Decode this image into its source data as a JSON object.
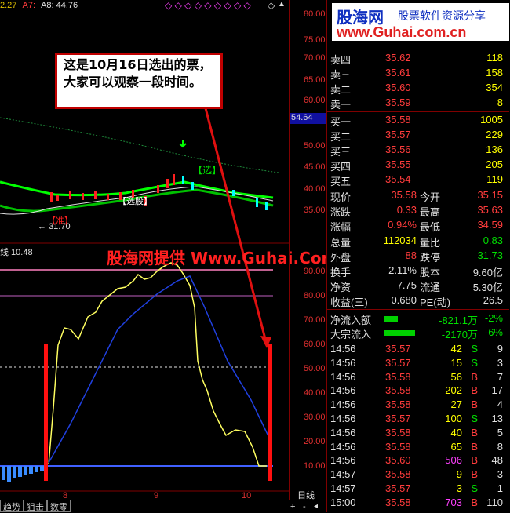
{
  "header": {
    "ma_a": "A7:",
    "ma_b": "A8: 44.76",
    "ma_left": "2.27",
    "prev_val": "54.64"
  },
  "watermark": {
    "logo": "股海网",
    "tagline": "股票软件资源分享",
    "url": "www.Guhai.com.cn",
    "overlay": "股海网提供 Www.Guhai.Com.cN"
  },
  "callout": {
    "text": "这是10月16日选出的票，大家可以观察一段时间。"
  },
  "chart_labels": {
    "select_tag": "【选】",
    "fund_tag": "【选股】",
    "low_price": "31.70",
    "zhu_label": "【准】",
    "sub_label": "线 10.48"
  },
  "price_axis": [
    "80.00",
    "75.00",
    "70.00",
    "65.00",
    "60.00",
    "55.00",
    "50.00",
    "45.00",
    "40.00",
    "35.00"
  ],
  "indicator_axis": [
    "90.00",
    "80.00",
    "70.00",
    "60.00",
    "50.00",
    "40.00",
    "30.00",
    "20.00",
    "10.00"
  ],
  "x_axis": [
    "8",
    "9",
    "10"
  ],
  "period": "日线",
  "bottom_tabs": [
    "趋势",
    "狙击",
    "数零"
  ],
  "quote": {
    "sell": [
      {
        "label": "卖四",
        "price": "35.62",
        "vol": "118"
      },
      {
        "label": "卖三",
        "price": "35.61",
        "vol": "158"
      },
      {
        "label": "卖二",
        "price": "35.60",
        "vol": "354"
      },
      {
        "label": "卖一",
        "price": "35.59",
        "vol": "8"
      }
    ],
    "buy": [
      {
        "label": "买一",
        "price": "35.58",
        "vol": "1005"
      },
      {
        "label": "买二",
        "price": "35.57",
        "vol": "229"
      },
      {
        "label": "买三",
        "price": "35.56",
        "vol": "136"
      },
      {
        "label": "买四",
        "price": "35.55",
        "vol": "205"
      },
      {
        "label": "买五",
        "price": "35.54",
        "vol": "119"
      }
    ],
    "stats": [
      {
        "l1": "现价",
        "v1": "35.58",
        "l2": "今开",
        "v2": "35.15"
      },
      {
        "l1": "涨跌",
        "v1": "0.33",
        "l2": "最高",
        "v2": "35.63"
      },
      {
        "l1": "涨幅",
        "v1": "0.94%",
        "l2": "最低",
        "v2": "34.59"
      },
      {
        "l1": "总量",
        "v1": "112034",
        "l2": "量比",
        "v2": "0.83"
      },
      {
        "l1": "外盘",
        "v1": "88",
        "l2": "跌停",
        "v2": "31.73"
      },
      {
        "l1": "换手",
        "v1": "2.11%",
        "l2": "股本",
        "v2": "9.60亿"
      },
      {
        "l1": "净资",
        "v1": "7.75",
        "l2": "流通",
        "v2": "5.30亿"
      },
      {
        "l1": "收益(三)",
        "v1": "0.680",
        "l2": "PE(动)",
        "v2": "26.5"
      }
    ],
    "flow": [
      {
        "label": "净流入额",
        "value": "-821.1万",
        "pct": "-2%"
      },
      {
        "label": "大宗流入",
        "value": "-2170万",
        "pct": "-6%"
      }
    ],
    "ticks": [
      {
        "t": "14:56",
        "p": "35.57",
        "v": "42",
        "s": "S",
        "n": "9"
      },
      {
        "t": "14:56",
        "p": "35.57",
        "v": "15",
        "s": "S",
        "n": "3"
      },
      {
        "t": "14:56",
        "p": "35.58",
        "v": "56",
        "s": "B",
        "n": "7"
      },
      {
        "t": "14:56",
        "p": "35.58",
        "v": "202",
        "s": "B",
        "n": "17"
      },
      {
        "t": "14:56",
        "p": "35.58",
        "v": "27",
        "s": "B",
        "n": "4"
      },
      {
        "t": "14:56",
        "p": "35.57",
        "v": "100",
        "s": "S",
        "n": "13"
      },
      {
        "t": "14:56",
        "p": "35.58",
        "v": "40",
        "s": "B",
        "n": "5"
      },
      {
        "t": "14:56",
        "p": "35.58",
        "v": "65",
        "s": "B",
        "n": "8"
      },
      {
        "t": "14:56",
        "p": "35.60",
        "v": "506",
        "s": "B",
        "n": "48"
      },
      {
        "t": "14:57",
        "p": "35.58",
        "v": "9",
        "s": "B",
        "n": "3"
      },
      {
        "t": "14:57",
        "p": "35.57",
        "v": "3",
        "s": "S",
        "n": "1"
      },
      {
        "t": "15:00",
        "p": "35.58",
        "v": "703",
        "s": "B",
        "n": "110"
      }
    ]
  }
}
